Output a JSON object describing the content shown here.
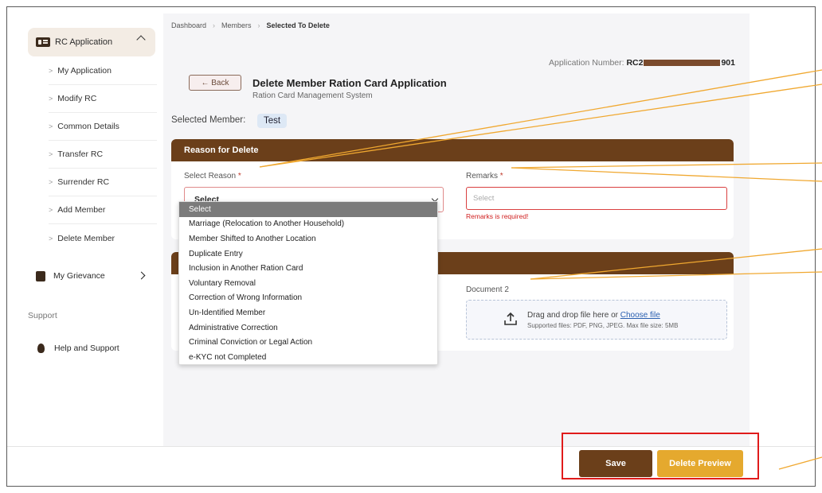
{
  "sidebar": {
    "section_label": "RC Application",
    "items": [
      {
        "label": "My Application"
      },
      {
        "label": "Modify RC"
      },
      {
        "label": "Common Details"
      },
      {
        "label": "Transfer RC"
      },
      {
        "label": "Surrender RC"
      },
      {
        "label": "Add Member"
      },
      {
        "label": "Delete Member"
      }
    ],
    "grievance_label": "My Grievance",
    "support_heading": "Support",
    "help_label": "Help and Support"
  },
  "breadcrumb": [
    "Dashboard",
    "Members",
    "Selected To Delete"
  ],
  "header": {
    "application_number_label": "Application Number:",
    "application_number_prefix": "RC2",
    "application_number_suffix": "901",
    "back_label": "← Back",
    "title": "Delete Member Ration Card Application",
    "subtitle": "Ration Card Management System"
  },
  "selected_member": {
    "label": "Selected Member:",
    "value": "Test"
  },
  "reason_section": {
    "heading": "Reason for Delete",
    "select_label": "Select Reason",
    "select_value": "Select",
    "remarks_label": "Remarks",
    "remarks_placeholder": "Select",
    "remarks_error": "Remarks is required!",
    "required_mark": "*"
  },
  "dropdown_options": [
    "Select",
    "Marriage (Relocation to Another Household)",
    "Member Shifted to Another Location",
    "Duplicate Entry",
    "Inclusion in Another Ration Card",
    "Voluntary Removal",
    "Correction of Wrong Information",
    "Un-Identified Member",
    "Administrative Correction",
    "Criminal Conviction or Legal Action",
    "e-KYC not Completed"
  ],
  "document_section": {
    "doc2_label": "Document 2",
    "drop_text": "Drag and drop file here or",
    "choose_file": "Choose file",
    "supported": "Supported files: PDF, PNG, JPEG. Max file size: 5MB"
  },
  "footer": {
    "save_label": "Save",
    "preview_label": "Delete Preview"
  },
  "colors": {
    "brand_brown": "#6b3f1a",
    "accent_amber": "#e5a92e",
    "error_red": "#d02020",
    "annotation": "#f0a830",
    "highlight": "#e01b1b"
  }
}
